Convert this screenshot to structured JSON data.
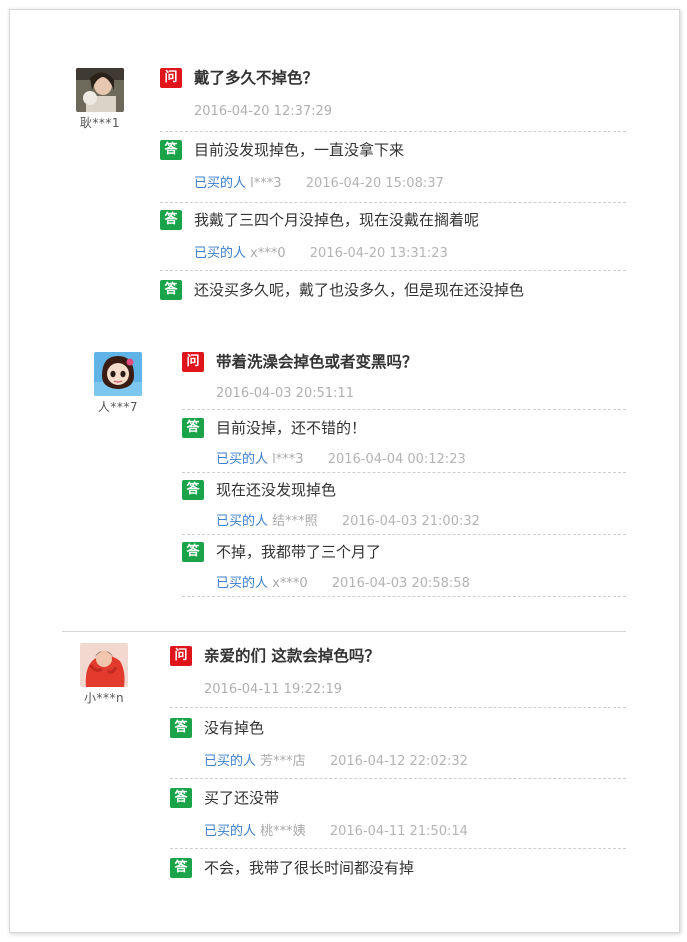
{
  "questions": [
    {
      "username": "耿***1",
      "q_badge": "问",
      "question": "戴了多久不掉色？",
      "date": "2016-04-20 12:37:29",
      "answers": [
        {
          "badge": "答",
          "text": "目前没发现掉色，一直没拿下来",
          "bought": "已买的人",
          "user": "l***3",
          "date": "2016-04-20 15:08:37"
        },
        {
          "badge": "答",
          "text": "我戴了三四个月没掉色，现在没戴在搁着呢",
          "bought": "已买的人",
          "user": "x***0",
          "date": "2016-04-20 13:31:23"
        },
        {
          "badge": "答",
          "text": "还没买多久呢，戴了也没多久，但是现在还没掉色"
        }
      ]
    },
    {
      "username": "人***7",
      "q_badge": "问",
      "question": "带着洗澡会掉色或者变黑吗？",
      "date": "2016-04-03 20:51:11",
      "answers": [
        {
          "badge": "答",
          "text": "目前没掉，还不错的！",
          "bought": "已买的人",
          "user": "l***3",
          "date": "2016-04-04 00:12:23"
        },
        {
          "badge": "答",
          "text": "现在还没发现掉色",
          "bought": "已买的人",
          "user": "结***照",
          "date": "2016-04-03 21:00:32"
        },
        {
          "badge": "答",
          "text": "不掉，我都带了三个月了",
          "bought": "已买的人",
          "user": "x***0",
          "date": "2016-04-03 20:58:58"
        }
      ]
    },
    {
      "username": "小***n",
      "q_badge": "问",
      "question": "亲爱的们 这款会掉色吗？",
      "date": "2016-04-11 19:22:19",
      "answers": [
        {
          "badge": "答",
          "text": "没有掉色",
          "bought": "已买的人",
          "user": "芳***店",
          "date": "2016-04-12 22:02:32"
        },
        {
          "badge": "答",
          "text": "买了还没带",
          "bought": "已买的人",
          "user": "桃***姨",
          "date": "2016-04-11 21:50:14"
        },
        {
          "badge": "答",
          "text": "不会，我带了很长时间都没有掉"
        }
      ]
    }
  ],
  "colors": {
    "question_badge": "#e0141b",
    "answer_badge": "#1aa349",
    "buyer_link": "#3b7fcf"
  }
}
